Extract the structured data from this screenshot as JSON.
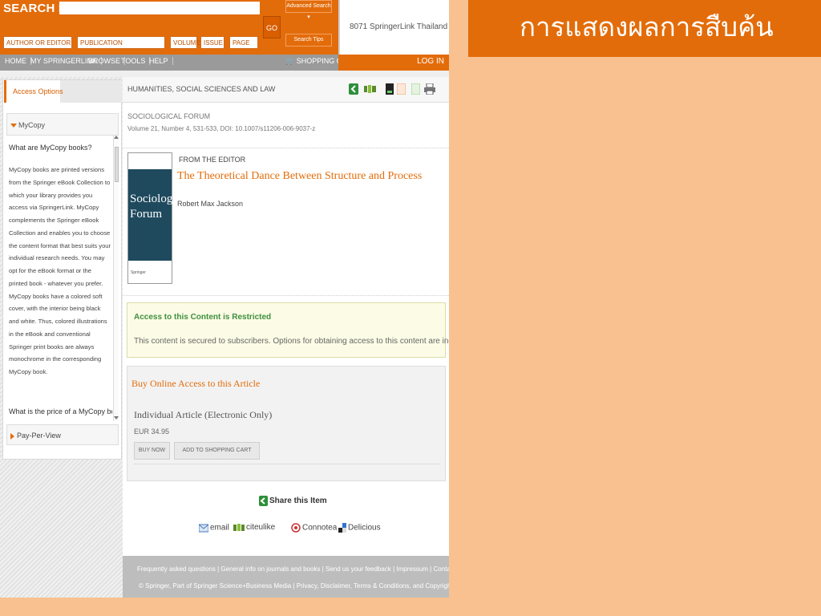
{
  "slide": {
    "title": "การแสดงผลการสืบค้น"
  },
  "colors": {
    "accent": "#e36c0a",
    "background": "#f8c18f",
    "restricted_green": "#3f8f3f"
  },
  "header": {
    "search_label": "SEARCH FOR",
    "fields": {
      "author": "AUTHOR OR EDITOR",
      "publication": "PUBLICATION",
      "volume": "VOLUME",
      "issue": "ISSUE",
      "page": "PAGE"
    },
    "go_label": "GO",
    "advanced_search": "Advanced Search",
    "search_tips": "Search Tips",
    "portal_name": "8071 SpringerLink Thailand"
  },
  "nav": {
    "items": [
      "HOME",
      "MY SPRINGERLINK",
      "BROWSE",
      "TOOLS",
      "HELP"
    ],
    "cart": "SHOPPING CART",
    "login": "LOG IN"
  },
  "sidebar": {
    "tab": "Access Options",
    "mycopy_head": "MyCopy",
    "mycopy_q1": "What are MyCopy books?",
    "mycopy_text": "MyCopy books are printed versions from the Springer eBook Collection to which your library provides you access via SpringerLink. MyCopy complements the Springer eBook Collection and enables you to choose the content format that best suits your individual research needs. You may opt for the eBook format or the printed book - whatever you prefer. MyCopy books have a colored soft cover, with the interior being black and white. Thus, colored illustrations in the eBook and conventional Springer print books are always monochrome in the corresponding MyCopy book.",
    "mycopy_q2": "What is the price of a MyCopy book?",
    "ppv": "Pay-Per-View"
  },
  "main": {
    "subject": "HUMANITIES, SOCIAL SCIENCES AND LAW",
    "journal": "SOCIOLOGICAL FORUM",
    "meta": "Volume 21, Number 4, 531-533, DOI: 10.1007/s11206-006-9037-z",
    "cover_title": "Sociological Forum",
    "cover_publisher": "Springer",
    "section": "FROM THE EDITOR",
    "article_title": "The Theoretical Dance Between Structure and Process",
    "author": "Robert Max Jackson"
  },
  "access": {
    "title": "Access to this Content is Restricted",
    "text": "This content is secured to subscribers. Options for obtaining access to this content are indicated below."
  },
  "buy": {
    "title": "Buy Online Access to this Article",
    "option": "Individual Article (Electronic Only)",
    "price": "EUR 34.95",
    "buy_now": "BUY NOW",
    "add_to_cart": "ADD TO SHOPPING CART"
  },
  "share": {
    "title": "Share this Item",
    "email": "email",
    "citeulike": "citeulike",
    "connotea": "Connotea",
    "delicious": "Delicious"
  },
  "footer": {
    "links": [
      "Frequently asked questions",
      "General info on journals and books",
      "Send us your feedback",
      "Impressum",
      "Contact us"
    ],
    "copyright": "© Springer, Part of Springer Science+Business Media",
    "legal": "Privacy, Disclaimer, Terms & Conditions, and Copyright Info"
  }
}
